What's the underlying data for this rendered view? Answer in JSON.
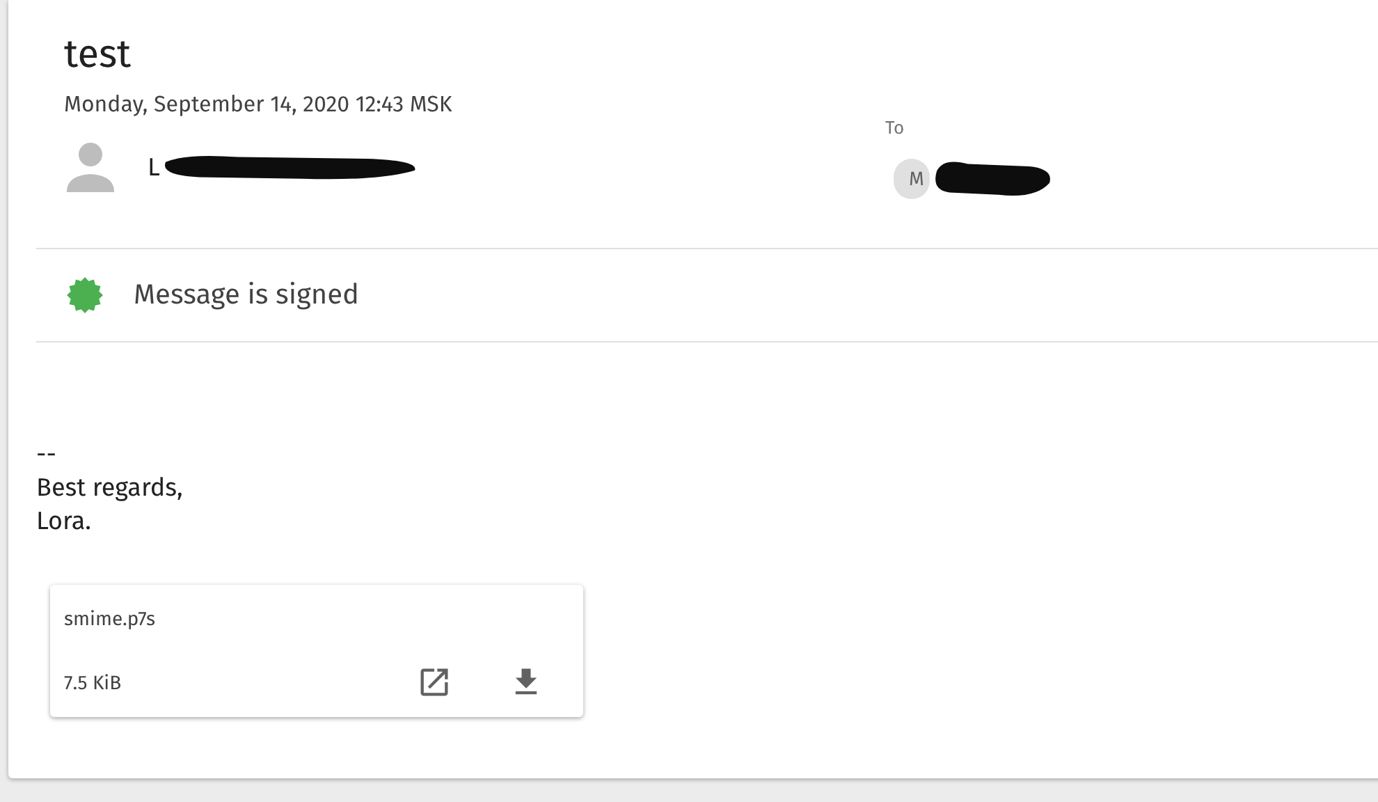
{
  "message": {
    "subject": "test",
    "date": "Monday, September 14, 2020 12:43 MSK",
    "sender": {
      "name": "L",
      "redacted": true
    },
    "to_label": "To",
    "recipients": [
      {
        "name": "M",
        "redacted": true
      }
    ],
    "signature_status": {
      "text": "Message is signed",
      "kind": "signed"
    },
    "body_lines": [
      "--",
      "Best regards,",
      "Lora."
    ],
    "attachments": [
      {
        "name": "smime.p7s",
        "size": "7.5 KiB"
      }
    ]
  }
}
